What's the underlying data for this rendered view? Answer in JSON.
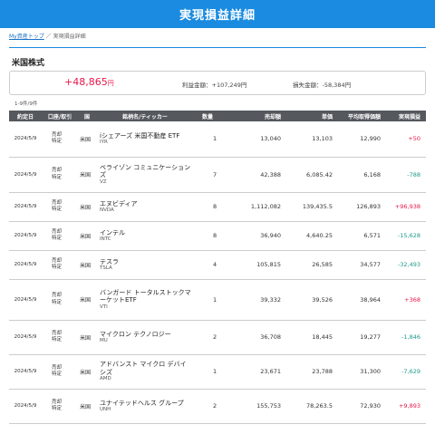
{
  "header": {
    "title": "実現損益詳細"
  },
  "breadcrumb": {
    "home": "My資産トップ",
    "separator": "／",
    "current": "実現損益詳細"
  },
  "section": {
    "title": "米国株式"
  },
  "summary": {
    "total": "+48,865",
    "total_unit": "円",
    "profit": "利益金額：+107,249円",
    "loss": "損失金額：-58,384円"
  },
  "count": "1-9件/9件",
  "columns": [
    "約定日",
    "口座/取引",
    "国",
    "銘柄名/ティッカー",
    "数量",
    "売却額",
    "単価",
    "平均取得価額",
    "実現損益"
  ],
  "rows": [
    {
      "date": "2024/5/9",
      "acct1": "売却",
      "acct2": "特定",
      "country": "米国",
      "name": "iシェアーズ 米国不動産 ETF",
      "ticker": "IYR",
      "qty": "1",
      "sale": "13,040",
      "price": "13,103",
      "avg": "12,990",
      "pl": "+50",
      "sign": "pos"
    },
    {
      "date": "2024/5/9",
      "acct1": "売却",
      "acct2": "特定",
      "country": "米国",
      "name": "ベライゾン コミュニケーションズ",
      "ticker": "VZ",
      "qty": "7",
      "sale": "42,388",
      "price": "6,085.42",
      "avg": "6,168",
      "pl": "-788",
      "sign": "neg"
    },
    {
      "date": "2024/5/9",
      "acct1": "売却",
      "acct2": "特定",
      "country": "米国",
      "name": "エヌビディア",
      "ticker": "NVDA",
      "qty": "8",
      "sale": "1,112,082",
      "price": "139,435.5",
      "avg": "126,893",
      "pl": "+96,938",
      "sign": "pos"
    },
    {
      "date": "2024/5/9",
      "acct1": "売却",
      "acct2": "特定",
      "country": "米国",
      "name": "インテル",
      "ticker": "INTC",
      "qty": "8",
      "sale": "36,940",
      "price": "4,640.25",
      "avg": "6,571",
      "pl": "-15,628",
      "sign": "neg"
    },
    {
      "date": "2024/5/9",
      "acct1": "売却",
      "acct2": "特定",
      "country": "米国",
      "name": "テスラ",
      "ticker": "TSLA",
      "qty": "4",
      "sale": "105,815",
      "price": "26,585",
      "avg": "34,577",
      "pl": "-32,493",
      "sign": "neg"
    },
    {
      "date": "2024/5/9",
      "acct1": "売却",
      "acct2": "特定",
      "country": "米国",
      "name": "バンガード トータルストックマーケットETF",
      "ticker": "VTI",
      "qty": "1",
      "sale": "39,332",
      "price": "39,526",
      "avg": "38,964",
      "pl": "+368",
      "sign": "pos"
    },
    {
      "date": "2024/5/9",
      "acct1": "売却",
      "acct2": "特定",
      "country": "米国",
      "name": "マイクロン テクノロジー",
      "ticker": "MU",
      "qty": "2",
      "sale": "36,708",
      "price": "18,445",
      "avg": "19,277",
      "pl": "-1,846",
      "sign": "neg"
    },
    {
      "date": "2024/5/9",
      "acct1": "売却",
      "acct2": "特定",
      "country": "米国",
      "name": "アドバンスト マイクロ デバイシズ",
      "ticker": "AMD",
      "qty": "1",
      "sale": "23,671",
      "price": "23,788",
      "avg": "31,300",
      "pl": "-7,629",
      "sign": "neg"
    },
    {
      "date": "2024/5/9",
      "acct1": "売却",
      "acct2": "特定",
      "country": "米国",
      "name": "ユナイテッドヘルス グループ",
      "ticker": "UNH",
      "qty": "2",
      "sale": "155,753",
      "price": "78,263.5",
      "avg": "72,930",
      "pl": "+9,893",
      "sign": "pos"
    }
  ],
  "colors": {
    "header": "#1a8be0",
    "table_head": "#55595e",
    "positive": "#e8174a",
    "negative": "#1d9a8a"
  }
}
